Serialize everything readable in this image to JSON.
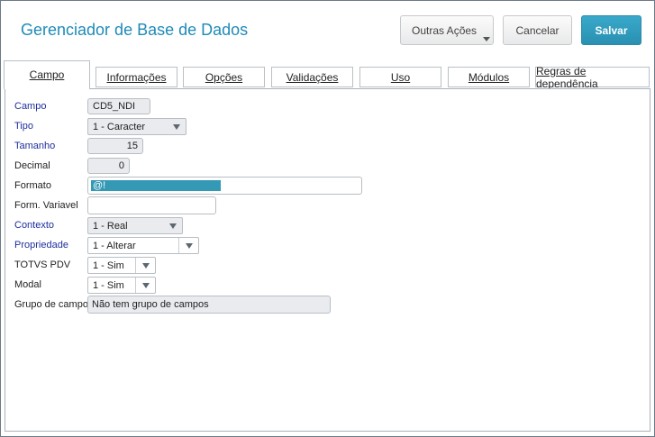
{
  "header": {
    "title": "Gerenciador de Base de Dados",
    "buttons": {
      "other_actions": "Outras Ações",
      "cancel": "Cancelar",
      "save": "Salvar"
    }
  },
  "tabs": [
    {
      "label": "Campo",
      "active": true
    },
    {
      "label": "Informações",
      "active": false
    },
    {
      "label": "Opções",
      "active": false
    },
    {
      "label": "Validações",
      "active": false
    },
    {
      "label": "Uso",
      "active": false
    },
    {
      "label": "Módulos",
      "active": false
    },
    {
      "label": "Regras de dependência",
      "active": false
    }
  ],
  "form": {
    "campo": {
      "label": "Campo",
      "value": "CD5_NDI"
    },
    "tipo": {
      "label": "Tipo",
      "value": "1 - Caracter"
    },
    "tamanho": {
      "label": "Tamanho",
      "value": "15"
    },
    "decimal": {
      "label": "Decimal",
      "value": "0"
    },
    "formato": {
      "label": "Formato",
      "value": "@!"
    },
    "form_variavel": {
      "label": "Form. Variavel",
      "value": ""
    },
    "contexto": {
      "label": "Contexto",
      "value": "1 - Real"
    },
    "propriedade": {
      "label": "Propriedade",
      "value": "1 - Alterar"
    },
    "totvs_pdv": {
      "label": "TOTVS PDV",
      "value": "1 - Sim"
    },
    "modal": {
      "label": "Modal",
      "value": "1 - Sim"
    },
    "grupo_campos": {
      "label": "Grupo de campos",
      "value": "Não tem grupo de campos"
    }
  },
  "colors": {
    "accent": "#1f8bb7",
    "save_button": "#2990b2",
    "required_label": "#1e2f9c",
    "selection": "#3399b5"
  }
}
